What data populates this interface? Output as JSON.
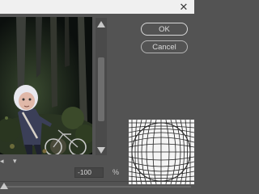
{
  "titlebar": {
    "close_glyph": "✕"
  },
  "buttons": {
    "ok": "OK",
    "cancel": "Cancel"
  },
  "amount": {
    "value": "-100",
    "unit": "%",
    "slider_fraction": 0.0
  },
  "icons": [
    "close-icon",
    "scroll-up-arrow-icon",
    "scroll-down-arrow-icon",
    "scroll-left-arrow-icon",
    "scroll-right-arrow-icon"
  ],
  "colors": {
    "dialog_bg": "#535353",
    "titlebar_bg": "#f0f0f0",
    "grid_bg": "#f4f4f4"
  }
}
